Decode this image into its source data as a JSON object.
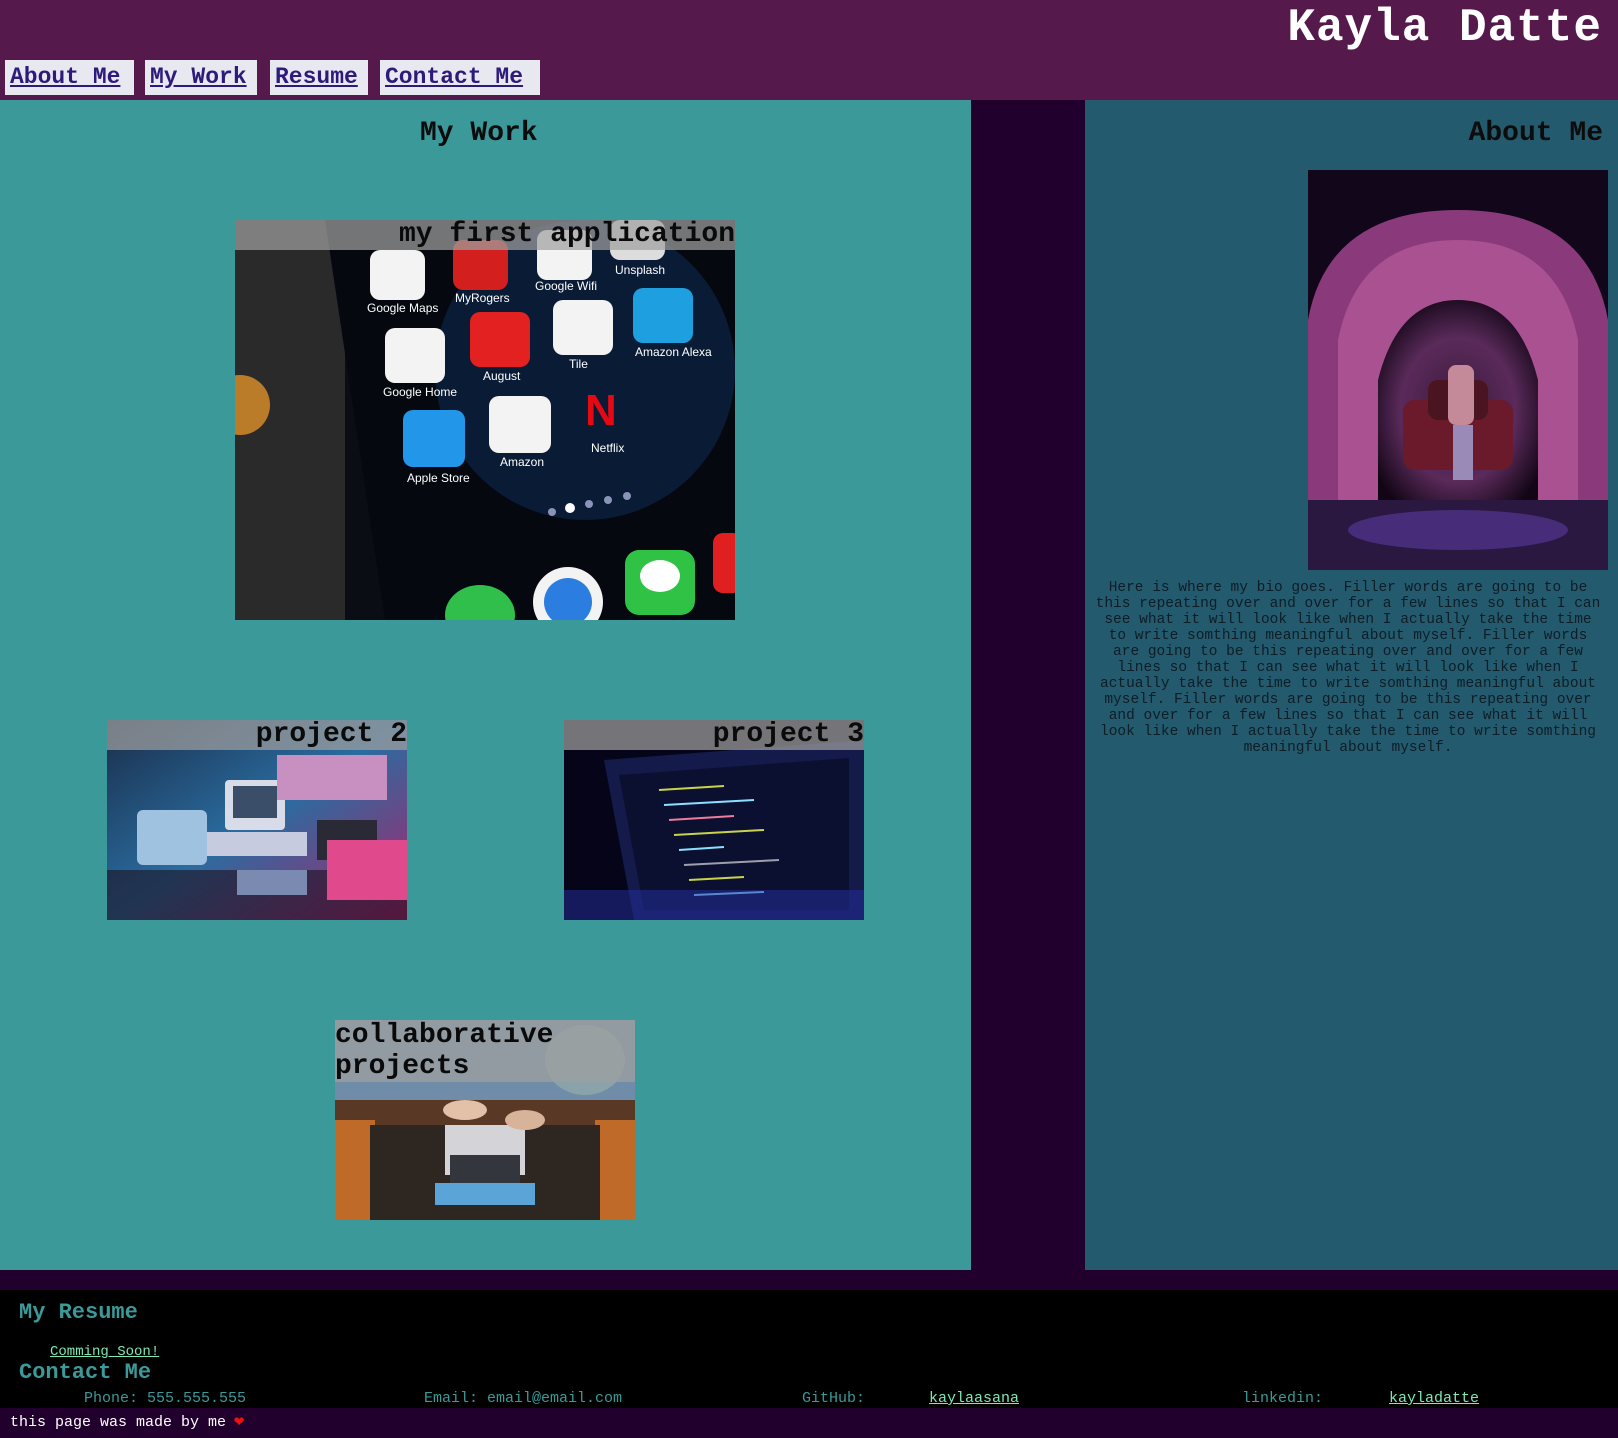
{
  "header": {
    "title": "Kayla Datte",
    "nav": [
      {
        "label": "About Me"
      },
      {
        "label": "My Work"
      },
      {
        "label": "Resume"
      },
      {
        "label": "Contact Me"
      }
    ]
  },
  "work": {
    "title": "My Work",
    "projects": [
      {
        "label": "my first application"
      },
      {
        "label": "project 2"
      },
      {
        "label": "project 3"
      },
      {
        "label": "collaborative projects"
      }
    ],
    "app_icons": [
      "Google Maps",
      "MyRogers",
      "Google Wifi",
      "Unsplash",
      "Google Home",
      "August",
      "Tile",
      "Amazon Alexa",
      "Apple Store",
      "Amazon",
      "Netflix"
    ]
  },
  "about": {
    "title": "About Me",
    "bio": "Here is where my bio goes. Filler words are going to be this repeating over and over for a few lines so that I can see what it will look like when I actually take the time to write somthing meaningful about myself. Filler words are going to be this repeating over and over for a few lines so that I can see what it will look like when I actually take the time to write somthing meaningful about myself. Filler words are going to be this repeating over and over for a few lines so that I can see what it will look like when I actually take the time to write somthing meaningful about myself."
  },
  "footer": {
    "resume_heading": "My Resume",
    "resume_link": "Comming Soon!",
    "contact_heading": "Contact Me",
    "phone": "Phone: 555.555.555",
    "email": "Email: email@email.com",
    "github_label": "GitHub:",
    "github_link": "kaylaasana",
    "linkedin_label": "linkedin:",
    "linkedin_link": "kayladatte"
  },
  "bottom": {
    "made_by": "this page was made by me"
  },
  "colors": {
    "header_bg": "#55194b",
    "work_bg": "#3b9999",
    "about_bg": "#245a6e",
    "page_bg": "#22002e",
    "link_green": "#7ee9b4"
  }
}
